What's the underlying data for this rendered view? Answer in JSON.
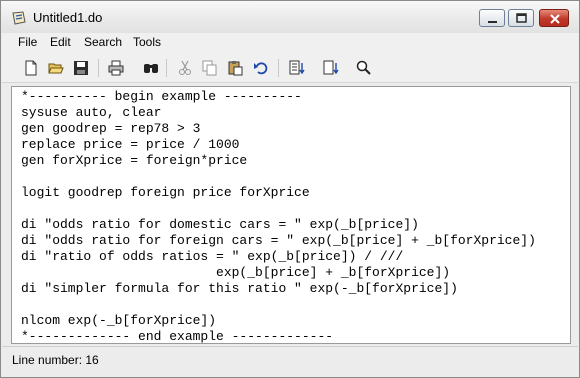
{
  "window": {
    "title": "Untitled1.do"
  },
  "menu": [
    "File",
    "Edit",
    "Search",
    "Tools"
  ],
  "toolbar": {
    "icons": [
      "new-file-icon",
      "open-folder-icon",
      "save-icon",
      "print-icon",
      "find-icon",
      "cut-icon",
      "copy-icon",
      "paste-icon",
      "undo-icon",
      "run-icon",
      "run-selection-icon",
      "preview-icon"
    ]
  },
  "editor": {
    "lines": [
      "*---------- begin example ----------",
      "sysuse auto, clear",
      "gen goodrep = rep78 > 3",
      "replace price = price / 1000",
      "gen forXprice = foreign*price",
      "",
      "logit goodrep foreign price forXprice",
      "",
      "di \"odds ratio for domestic cars = \" exp(_b[price])",
      "di \"odds ratio for foreign cars = \" exp(_b[price] + _b[forXprice])",
      "di \"ratio of odds ratios = \" exp(_b[price]) / ///",
      "                         exp(_b[price] + _b[forXprice])",
      "di \"simpler formula for this ratio \" exp(-_b[forXprice])",
      "",
      "nlcom exp(-_b[forXprice])",
      "*------------- end example -------------"
    ]
  },
  "status": {
    "text": "Line number: 16"
  },
  "colors": {
    "close_button": "#c0392b",
    "editor_bg": "#ffffff"
  }
}
